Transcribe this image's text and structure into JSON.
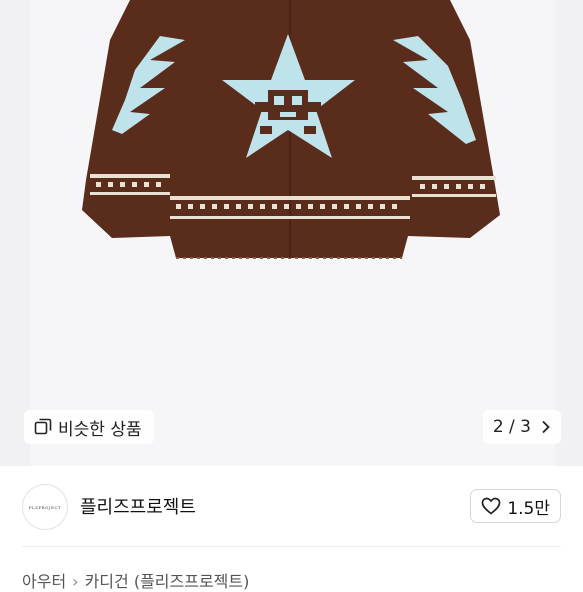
{
  "image_viewer": {
    "similar_label": "비슷한 상품",
    "page_indicator": "2 / 3",
    "similar_icon": "copy-icon",
    "next_icon": "chevron-right-icon"
  },
  "seller": {
    "avatar_text": "PLZPROJECT",
    "name": "플리즈프로젝트",
    "like_count": "1.5만",
    "like_icon": "heart-outline-icon"
  },
  "breadcrumb": {
    "items": [
      "아우터",
      "카디건 (플리즈프로젝트)"
    ],
    "separator": "›"
  },
  "colors": {
    "sweater_brown": "#5a2c1c",
    "motif_light_blue": "#bfe3ea",
    "cream_pattern": "#e9e2d3"
  }
}
